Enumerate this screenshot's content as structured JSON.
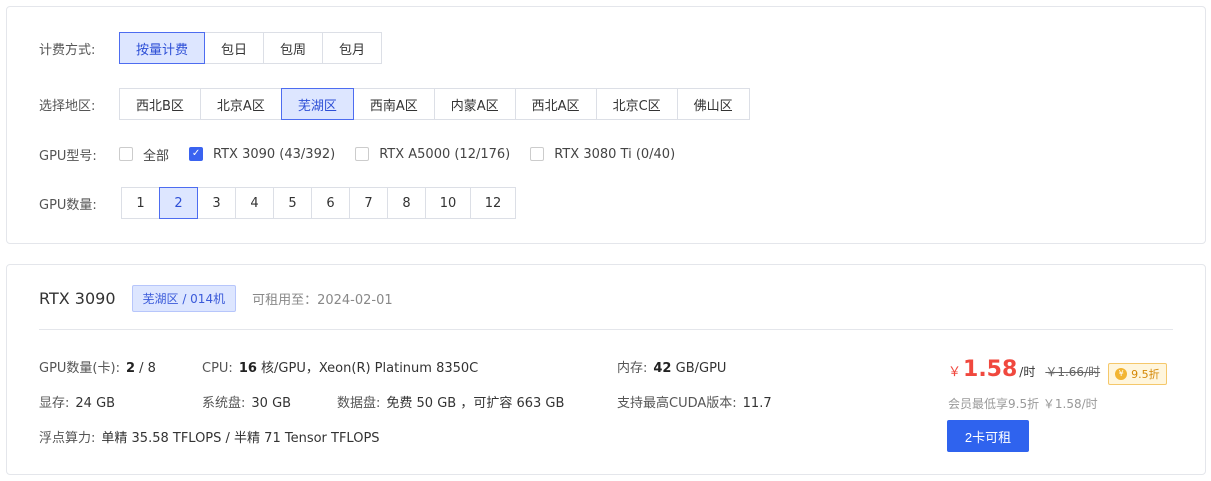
{
  "filters": {
    "billing": {
      "label": "计费方式:",
      "options": [
        "按量计费",
        "包日",
        "包周",
        "包月"
      ],
      "selected": "按量计费"
    },
    "region": {
      "label": "选择地区:",
      "options": [
        "西北B区",
        "北京A区",
        "芜湖区",
        "西南A区",
        "内蒙A区",
        "西北A区",
        "北京C区",
        "佛山区"
      ],
      "selected": "芜湖区"
    },
    "gpu_model": {
      "label": "GPU型号:",
      "options": [
        {
          "label": "全部",
          "checked": false
        },
        {
          "label": "RTX 3090 (43/392)",
          "checked": true
        },
        {
          "label": "RTX A5000 (12/176)",
          "checked": false
        },
        {
          "label": "RTX 3080 Ti (0/40)",
          "checked": false
        }
      ]
    },
    "gpu_count": {
      "label": "GPU数量:",
      "options": [
        "1",
        "2",
        "3",
        "4",
        "5",
        "6",
        "7",
        "8",
        "10",
        "12"
      ],
      "selected": "2"
    }
  },
  "card": {
    "gpu_name": "RTX 3090",
    "region_tag": "芜湖区 / 014机",
    "rent_until": "可租用至：2024-02-01",
    "specs": {
      "gpu_count_label": "GPU数量(卡):",
      "gpu_count_value": "2",
      "gpu_count_total": " / 8",
      "cpu_label": "CPU:",
      "cpu_cores": "16",
      "cpu_rest": "核/GPU，Xeon(R) Platinum 8350C",
      "mem_label": "内存:",
      "mem_value": "42",
      "mem_unit": "GB/GPU",
      "vram_label": "显存:",
      "vram_value": "24 GB",
      "sysdisk_label": "系统盘:",
      "sysdisk_value": "30 GB",
      "datadisk_label": "数据盘:",
      "datadisk_value": "免费 50 GB ，可扩容 663 GB",
      "cuda_label": "支持最高CUDA版本:",
      "cuda_value": "11.7",
      "flops_label": "浮点算力:",
      "flops_value": "单精 35.58 TFLOPS / 半精 71 Tensor TFLOPS"
    },
    "price": {
      "currency": "￥",
      "value": "1.58",
      "unit": "/时",
      "original": "￥1.66/时",
      "discount": "9.5折",
      "member_note": "会员最低享9.5折 ￥1.58/时"
    },
    "rent_button": "2卡可租"
  },
  "colors": {
    "accent": "#2f63ee",
    "selected_bg": "#dde6ff",
    "price_red": "#f0483e",
    "badge_gold": "#f2b533"
  }
}
